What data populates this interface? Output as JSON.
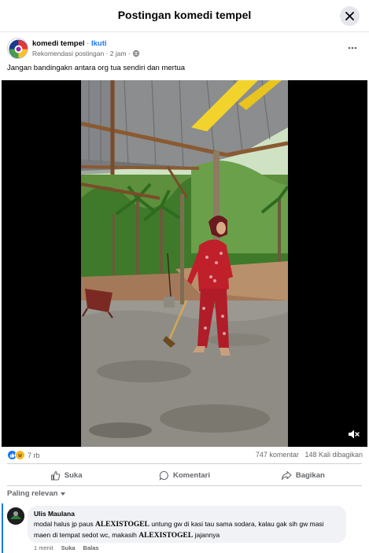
{
  "dialog": {
    "title": "Postingan komedi tempel"
  },
  "post": {
    "author": "komedi tempel",
    "separator": "·",
    "follow": "Ikuti",
    "subtitle": "Rekomendasi postingan · 2 jam ·",
    "caption": "Jangan bandingakn antara org tua sendiri dan mertua"
  },
  "stats": {
    "reaction_count": "7 rb",
    "comments": "747 komentar",
    "shares": "148 Kali dibagikan"
  },
  "actions": {
    "like": "Suka",
    "comment": "Komentari",
    "share": "Bagikan"
  },
  "sort": {
    "label": "Paling relevan"
  },
  "comment": {
    "author": "Ulis Maulana",
    "part1": "modal halus jp paus ",
    "brand": "ALEXISTOGEL",
    "part2": " untung gw di kasi tau sama sodara, kalau gak sih gw masi maen di tempat sedot wc, makasih ",
    "brand2": "ALEXISTOGEL",
    "part3": " jajannya",
    "time": "1 menit",
    "like": "Suka",
    "reply": "Balas"
  },
  "colors": {
    "accent": "#1877f2",
    "muted": "#65676b",
    "bubble": "#f0f2f5",
    "dress": "#c0202a"
  },
  "icons": [
    "close-icon",
    "more-icon",
    "globe-icon",
    "mute-icon",
    "like-reaction-icon",
    "haha-reaction-icon",
    "thumb-icon",
    "comment-icon",
    "share-icon",
    "chevron-down-icon"
  ]
}
